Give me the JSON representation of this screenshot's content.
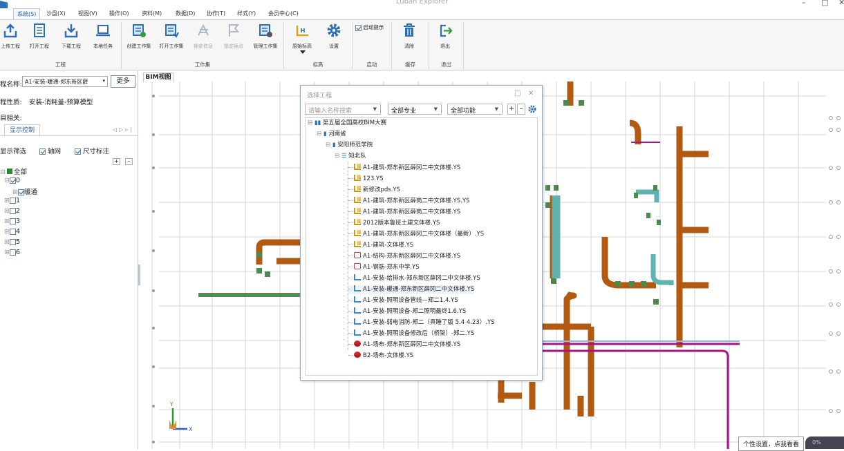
{
  "window": {
    "title": "Luban Explorer"
  },
  "menu": [
    "系统(S)",
    "沙盘(X)",
    "视图(V)",
    "操作(O)",
    "资料(M)",
    "数据(D)",
    "协作(T)",
    "样式(Y)",
    "会员中心(C)"
  ],
  "ribbon": {
    "buttons": [
      "上传工程",
      "打开工程",
      "下载工程",
      "本地任务",
      "创建工作集",
      "打开工作集",
      "锁定信息",
      "锁定插点",
      "管理工作集",
      "原始标高",
      "设置",
      "清除",
      "退出"
    ],
    "auto_hint": "启动提示",
    "groups": [
      "工程",
      "工作集",
      "标高",
      "启动",
      "缓存",
      "退出"
    ]
  },
  "left_panel": {
    "project_name_label": "程名称:",
    "project_name_value": "A1-安装-暖通-郑东新区薛",
    "more_button": "更多",
    "project_type_label": "程性质:",
    "project_type_value": "安装-消耗量-预算模型",
    "related_label": "目相关:",
    "display_tab": "显示控制",
    "filter_label": "显示筛选",
    "axis_grid_label": "轴网",
    "dimension_label": "尺寸标注",
    "tree_root": "全部",
    "tree_nodes": [
      "0",
      "暖通",
      "1",
      "2",
      "3",
      "4",
      "5",
      "6"
    ]
  },
  "viewport": {
    "tab": "BIM视图"
  },
  "dialog": {
    "title": "选择工程",
    "search_placeholder": "请输入名称搜索",
    "specialty": "全部专业",
    "function": "全部功能",
    "tree": {
      "root": "第五届全国高校BIM大赛",
      "province": "河南省",
      "school": "安阳师范学院",
      "team": "知北队",
      "files": [
        {
          "name": "A1-建筑-郑东新区薛冈二中文体楼.YS",
          "type": "ys"
        },
        {
          "name": "123.YS",
          "type": "ys"
        },
        {
          "name": "新修改pds.YS",
          "type": "ys"
        },
        {
          "name": "A1-建筑-郑东新区薛岗二中文体楼.YS.YS",
          "type": "ys"
        },
        {
          "name": "A1-建筑-郑东新区薛岗二中文体楼.YS",
          "type": "ys"
        },
        {
          "name": "2012版本鲁班土建文体楼.YS",
          "type": "ys"
        },
        {
          "name": "A1-建筑-郑东新区薛冈二中文体楼（最新）.YS",
          "type": "ys"
        },
        {
          "name": "A1-建筑-文体楼.YS",
          "type": "ys"
        },
        {
          "name": "A1-结构-郑东新区薛冈二中文体楼.YS",
          "type": "jg"
        },
        {
          "name": "A1-钢筋-郑东中学.YS",
          "type": "jg"
        },
        {
          "name": "A1-安装-给排水-郑东新区薛冈二中文体楼.YS",
          "type": "az"
        },
        {
          "name": "A1-安装-暖通-郑东新区薛冈二中文体楼.YS",
          "type": "az"
        },
        {
          "name": "A1-安装-照明设备管线—郑二1.4.YS",
          "type": "az"
        },
        {
          "name": "A1-安装-照明设备-郑二照明最终1.6.YS",
          "type": "az"
        },
        {
          "name": "A1-安装-弱电消防-郑二（真睡了版 5.4  4.23）.YS",
          "type": "az"
        },
        {
          "name": "A1-安装-照明设备修改后（桥架）-郑二.YS",
          "type": "az"
        },
        {
          "name": "A1-场布-郑东新区薛冈二中文体楼.YS",
          "type": "cb"
        },
        {
          "name": "B2-场布-文体楼.YS",
          "type": "cb"
        }
      ]
    }
  },
  "footer": {
    "tooltip": "个性设置，点我看看",
    "speed": "0%"
  },
  "colors": {
    "pipe": "#b35a12",
    "pipe_teal": "#5fb2b0",
    "magenta": "#a7148a",
    "accent": "#1e5a9e"
  }
}
